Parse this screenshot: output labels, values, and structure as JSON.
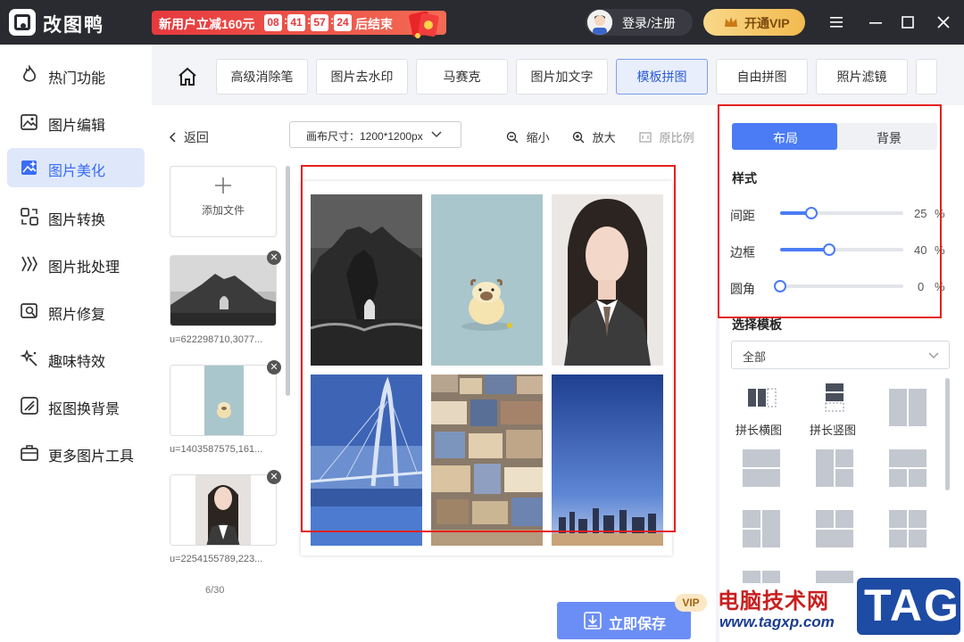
{
  "app": {
    "title": "改图鸭"
  },
  "promo": {
    "text": "新用户立减160元",
    "hours": "08",
    "minutes": "41",
    "seconds": "57",
    "centis": "24",
    "suffix": "后结束",
    "sep": ":"
  },
  "header": {
    "login_label": "登录/注册",
    "vip_label": "开通VIP"
  },
  "sidebar": {
    "items": [
      {
        "label": "热门功能",
        "icon": "fire-icon"
      },
      {
        "label": "图片编辑",
        "icon": "image-edit-icon"
      },
      {
        "label": "图片美化",
        "icon": "image-beauty-icon",
        "active": true
      },
      {
        "label": "图片转换",
        "icon": "convert-icon"
      },
      {
        "label": "图片批处理",
        "icon": "batch-icon"
      },
      {
        "label": "照片修复",
        "icon": "repair-icon"
      },
      {
        "label": "趣味特效",
        "icon": "sparkle-icon"
      },
      {
        "label": "抠图换背景",
        "icon": "cutout-icon"
      },
      {
        "label": "更多图片工具",
        "icon": "toolbox-icon"
      }
    ]
  },
  "toolbar": {
    "tabs": [
      {
        "label": "高级消除笔"
      },
      {
        "label": "图片去水印"
      },
      {
        "label": "马赛克"
      },
      {
        "label": "图片加文字"
      },
      {
        "label": "模板拼图",
        "active": true
      },
      {
        "label": "自由拼图"
      },
      {
        "label": "照片滤镜"
      }
    ]
  },
  "editor": {
    "back_label": "返回",
    "canvas_size_label": "画布尺寸：1200*1200px",
    "zoom_out_label": "缩小",
    "zoom_in_label": "放大",
    "original_ratio_label": "原比例",
    "add_file_label": "添加文件",
    "files": [
      {
        "name": "u=622298710,3077..."
      },
      {
        "name": "u=1403587575,161..."
      },
      {
        "name": "u=2254155789,223..."
      }
    ],
    "page_count": "6/30",
    "save_label": "立即保存",
    "vip_tag": "VIP"
  },
  "right_panel": {
    "tab_layout": "布局",
    "tab_background": "背景",
    "style_title": "样式",
    "sliders": [
      {
        "label": "间距",
        "value": "25",
        "unit": "%",
        "fraction": 0.25
      },
      {
        "label": "边框",
        "value": "40",
        "unit": "%",
        "fraction": 0.4
      },
      {
        "label": "圆角",
        "value": "0",
        "unit": "%",
        "fraction": 0.0
      }
    ],
    "template_title": "选择模板",
    "template_filter": "全部",
    "templates": [
      {
        "label": "拼长横图"
      },
      {
        "label": "拼长竖图"
      }
    ]
  },
  "watermark": {
    "text": "电脑技术网",
    "url": "www.tagxp.com",
    "tag": "TAG"
  },
  "colors": {
    "accent": "#4b7cf5",
    "highlight": "#e5211d",
    "titlebar": "#2a2b30"
  }
}
